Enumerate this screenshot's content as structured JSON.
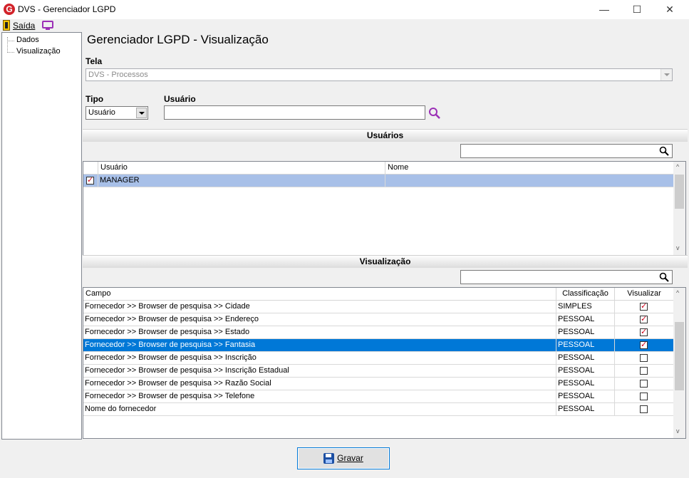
{
  "window": {
    "title": "DVS - Gerenciador LGPD",
    "app_icon_letter": "G",
    "minimize": "—",
    "maximize": "☐",
    "close": "✕"
  },
  "menu": {
    "exit_label": "Saída"
  },
  "sidebar": {
    "items": [
      {
        "label": "Dados"
      },
      {
        "label": "Visualização"
      }
    ]
  },
  "main": {
    "title": "Gerenciador LGPD - Visualização",
    "tela_label": "Tela",
    "tela_value": "DVS - Processos",
    "tipo_label": "Tipo",
    "tipo_value": "Usuário",
    "usuario_label": "Usuário",
    "usuario_value": ""
  },
  "usuarios_section": {
    "header": "Usuários",
    "search_value": "",
    "columns": [
      "",
      "Usuário",
      "Nome"
    ],
    "rows": [
      {
        "checked": true,
        "usuario": "MANAGER",
        "nome": ""
      }
    ]
  },
  "visualizacao_section": {
    "header": "Visualização",
    "search_value": "",
    "columns": [
      "Campo",
      "Classificação",
      "Visualizar"
    ],
    "rows": [
      {
        "campo": "Fornecedor >> Browser de pesquisa >> Cidade",
        "classificacao": "SIMPLES",
        "visualizar": true
      },
      {
        "campo": "Fornecedor >> Browser de pesquisa >> Endereço",
        "classificacao": "PESSOAL",
        "visualizar": true
      },
      {
        "campo": "Fornecedor >> Browser de pesquisa >> Estado",
        "classificacao": "PESSOAL",
        "visualizar": true
      },
      {
        "campo": "Fornecedor >> Browser de pesquisa >> Fantasia",
        "classificacao": "PESSOAL",
        "visualizar": true
      },
      {
        "campo": "Fornecedor >> Browser de pesquisa >> Inscrição",
        "classificacao": "PESSOAL",
        "visualizar": false
      },
      {
        "campo": "Fornecedor >> Browser de pesquisa >> Inscrição Estadual",
        "classificacao": "PESSOAL",
        "visualizar": false
      },
      {
        "campo": "Fornecedor >> Browser de pesquisa >> Razão Social",
        "classificacao": "PESSOAL",
        "visualizar": false
      },
      {
        "campo": "Fornecedor >> Browser de pesquisa >> Telefone",
        "classificacao": "PESSOAL",
        "visualizar": false
      },
      {
        "campo": "Nome do fornecedor",
        "classificacao": "PESSOAL",
        "visualizar": false
      }
    ]
  },
  "footer": {
    "save_label": "Gravar"
  },
  "colors": {
    "selection_blue": "#0078d7",
    "selection_light": "#a8c0e8",
    "check_red": "#d0021b",
    "accent_purple": "#9b2fb6"
  }
}
